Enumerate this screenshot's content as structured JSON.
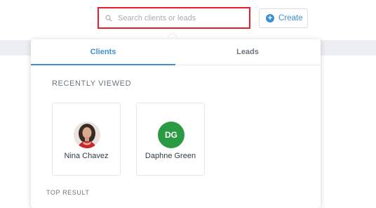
{
  "search": {
    "placeholder": "Search clients or leads"
  },
  "create_button": {
    "label": "Create"
  },
  "tabs": [
    {
      "label": "Clients",
      "active": true
    },
    {
      "label": "Leads",
      "active": false
    }
  ],
  "recently_viewed": {
    "title": "RECENTLY VIEWED",
    "items": [
      {
        "name": "Nina Chavez",
        "avatar": "photo"
      },
      {
        "name": "Daphne Green",
        "initials": "DG",
        "avatar_color": "#2b9b43"
      }
    ]
  },
  "top_result": {
    "title": "TOP RESULT"
  },
  "colors": {
    "accent": "#3d8fd4",
    "highlight_border": "#e4202a"
  }
}
